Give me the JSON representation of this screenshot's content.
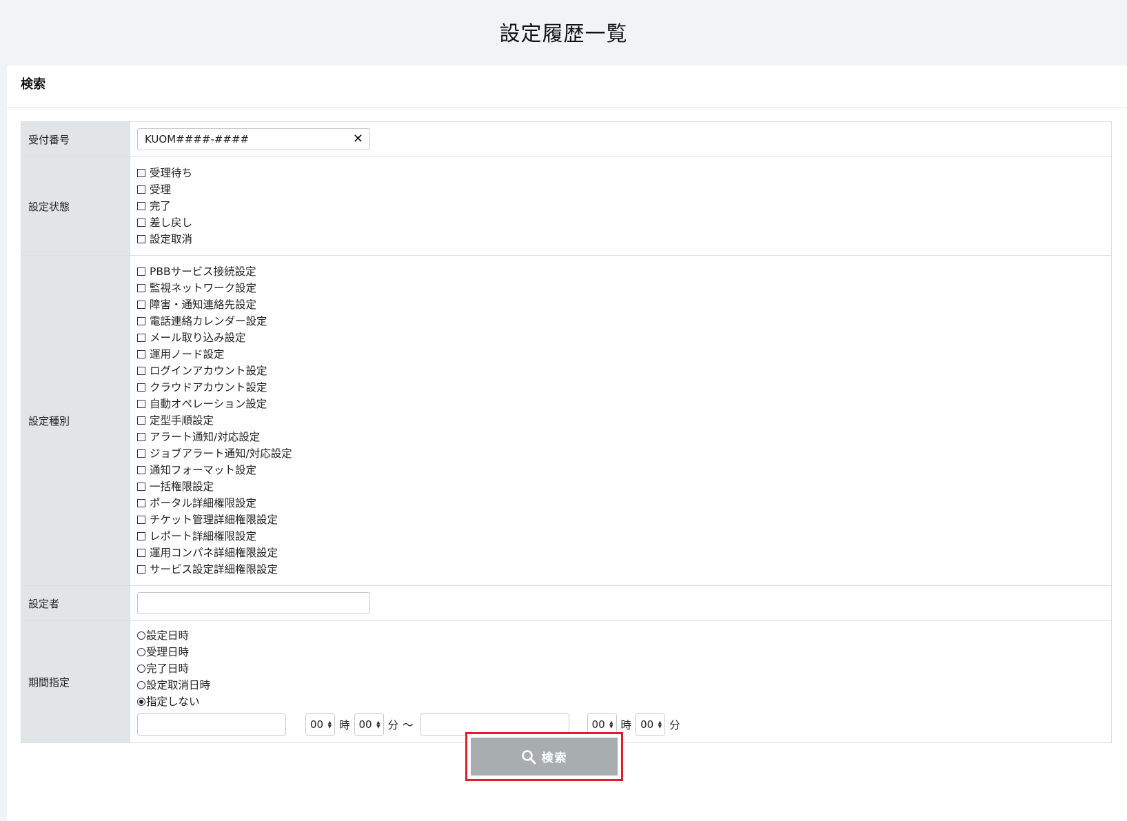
{
  "page": {
    "title": "設定履歴一覧"
  },
  "search_panel": {
    "header": "検索"
  },
  "fields": {
    "receipt_number": {
      "label": "受付番号",
      "value": "KUOM####-####",
      "clear_glyph": "✕"
    },
    "setting_status": {
      "label": "設定状態",
      "options": [
        "受理待ち",
        "受理",
        "完了",
        "差し戻し",
        "設定取消"
      ]
    },
    "setting_type": {
      "label": "設定種別",
      "options": [
        "PBBサービス接続設定",
        "監視ネットワーク設定",
        "障害・通知連絡先設定",
        "電話連絡カレンダー設定",
        "メール取り込み設定",
        "運用ノード設定",
        "ログインアカウント設定",
        "クラウドアカウント設定",
        "自動オペレーション設定",
        "定型手順設定",
        "アラート通知/対応設定",
        "ジョブアラート通知/対応設定",
        "通知フォーマット設定",
        "一括権限設定",
        "ポータル詳細権限設定",
        "チケット管理詳細権限設定",
        "レポート詳細権限設定",
        "運用コンパネ詳細権限設定",
        "サービス設定詳細権限設定"
      ]
    },
    "setter": {
      "label": "設定者",
      "value": ""
    },
    "period": {
      "label": "期間指定",
      "options": [
        {
          "label": "設定日時",
          "selected": false
        },
        {
          "label": "受理日時",
          "selected": false
        },
        {
          "label": "完了日時",
          "selected": false
        },
        {
          "label": "設定取消日時",
          "selected": false
        },
        {
          "label": "指定しない",
          "selected": true
        }
      ],
      "from": {
        "date": "",
        "hour": "00",
        "minute": "00"
      },
      "to": {
        "date": "",
        "hour": "00",
        "minute": "00"
      },
      "hour_unit": "時",
      "minute_unit": "分",
      "range_sep": "〜"
    }
  },
  "search_button": {
    "label": "検索",
    "icon": "search-icon"
  },
  "colors": {
    "highlight_border": "#e11d25",
    "button_bg": "#a8adb0",
    "label_bg": "#e1e5e8"
  }
}
